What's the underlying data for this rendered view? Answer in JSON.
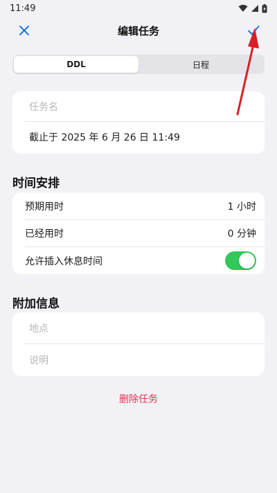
{
  "status_bar": {
    "time": "11:49"
  },
  "header": {
    "title": "编辑任务"
  },
  "segment": {
    "options": [
      "DDL",
      "日程"
    ],
    "selected": "DDL"
  },
  "task": {
    "name_placeholder": "任务名",
    "deadline": "截止于 2025 年 6 月 26 日 11:49"
  },
  "schedule": {
    "title": "时间安排",
    "rows": [
      {
        "label": "预期用时",
        "value": "1 小时"
      },
      {
        "label": "已经用时",
        "value": "0 分钟"
      }
    ],
    "break_label": "允许插入休息时间",
    "break_enabled": true
  },
  "extra": {
    "title": "附加信息",
    "location_placeholder": "地点",
    "description_placeholder": "说明"
  },
  "delete_label": "删除任务",
  "colors": {
    "accent": "#1a73e8",
    "toggle_on": "#34c759",
    "danger": "#e7314f",
    "annotation": "#d81f26"
  }
}
